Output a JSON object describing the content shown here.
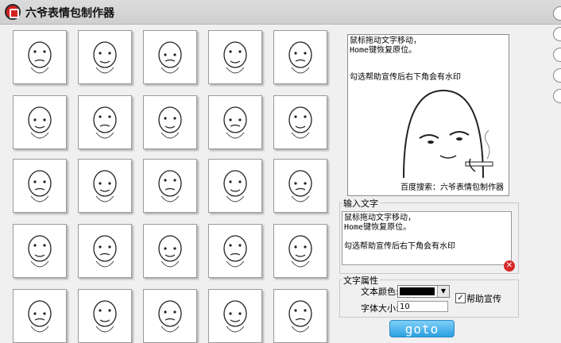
{
  "app": {
    "title": "六爷表情包制作器",
    "icon": "app-logo-icon",
    "accent": "#d42020"
  },
  "thumbnails": [
    "meme-face-icon",
    "meme-face-icon",
    "meme-face-icon",
    "meme-face-icon",
    "meme-face-icon",
    "meme-face-icon",
    "meme-face-icon",
    "meme-face-icon",
    "meme-face-icon",
    "meme-face-icon",
    "meme-face-icon",
    "meme-face-icon",
    "meme-face-icon",
    "meme-face-icon",
    "meme-face-icon",
    "meme-face-icon",
    "meme-face-icon",
    "meme-face-icon",
    "meme-face-icon",
    "meme-face-icon",
    "meme-face-icon",
    "meme-face-icon",
    "meme-face-icon",
    "meme-face-icon",
    "meme-face-icon"
  ],
  "preview": {
    "line1": "鼠标拖动文字移动，",
    "line2": "Home键恢复原位。",
    "line3": "勾选帮助宣传后右下角会有水印",
    "watermark": "百度搜索：六爷表情包制作器"
  },
  "input_section": {
    "label": "输入文字",
    "text": "鼠标拖动文字移动，\nHome键恢复原位。\n\n勾选帮助宣传后右下角会有水印",
    "clear_icon": "clear-icon"
  },
  "text_props": {
    "label": "文字属性",
    "color_label": "文本颜色:",
    "color_value": "#000000",
    "size_label": "字体大小:",
    "size_value": "10",
    "help_label": "帮助宣传",
    "help_checked": true,
    "check_mark": "✓"
  },
  "goto_button": {
    "label": "goto",
    "color": "#2b9fe0"
  },
  "side_icons": [
    "side-tab-icon",
    "side-tab-icon",
    "side-tab-icon",
    "side-tab-icon",
    "side-tab-icon"
  ]
}
